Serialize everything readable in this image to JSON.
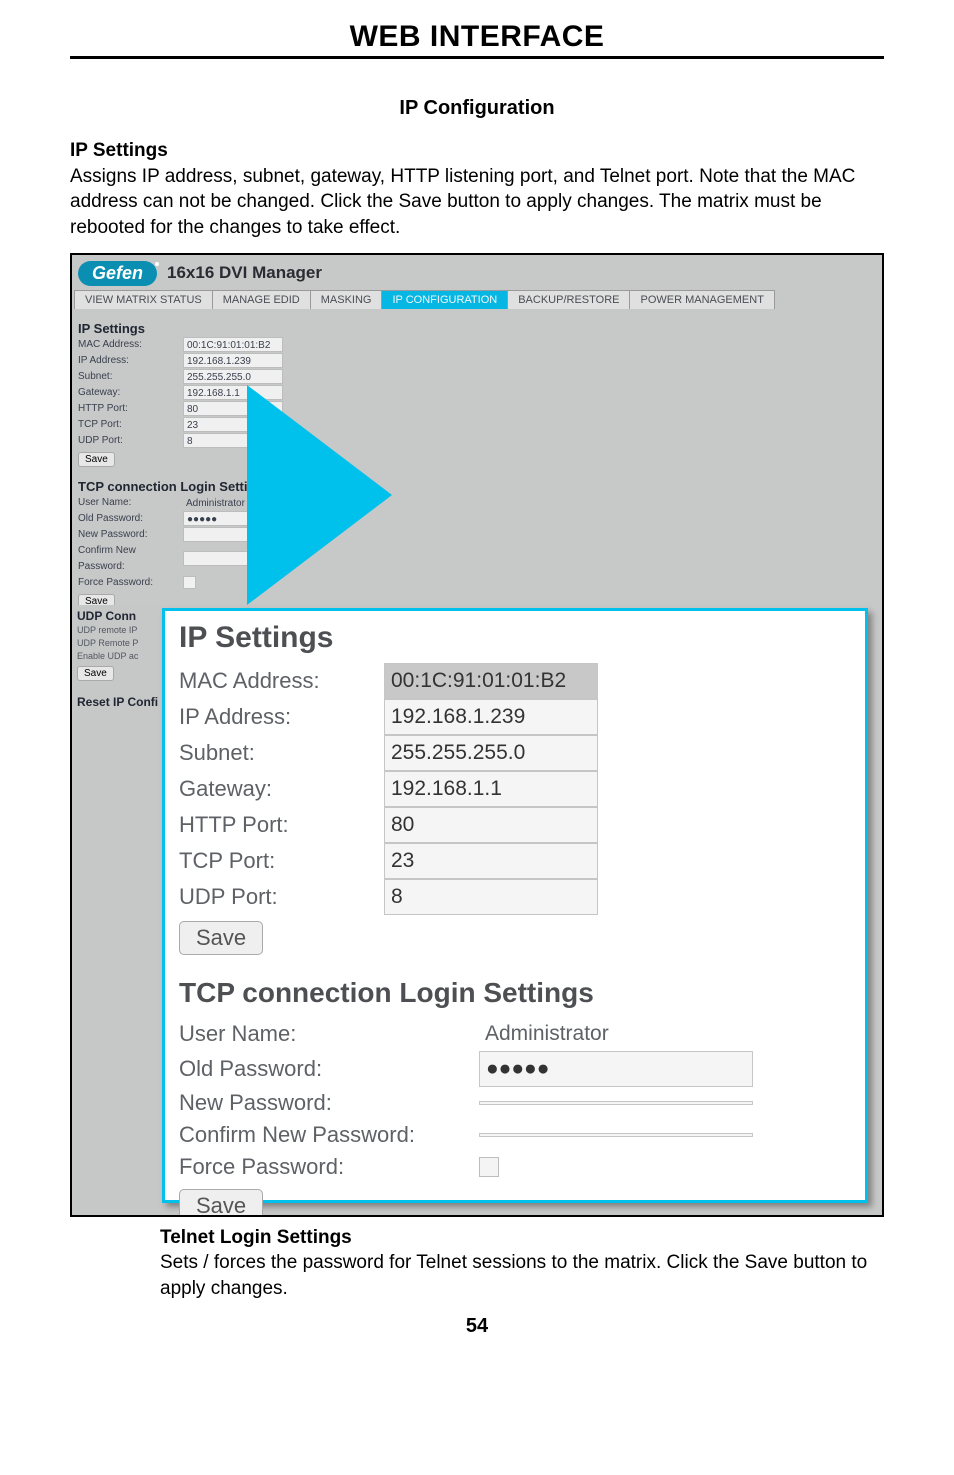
{
  "header": "WEB INTERFACE",
  "subtitle": "IP Configuration",
  "intro": {
    "heading": "IP Settings",
    "text": "Assigns IP address, subnet, gateway, HTTP listening port, and Telnet port. Note that the MAC address can not be changed.  Click the Save button to apply changes.  The matrix must be rebooted for the changes to take effect."
  },
  "brand": {
    "logo": "Gefen",
    "subtitle": "16x16 DVI Manager"
  },
  "tabs": [
    "VIEW MATRIX STATUS",
    "MANAGE EDID",
    "MASKING",
    "IP CONFIGURATION",
    "BACKUP/RESTORE",
    "POWER MANAGEMENT"
  ],
  "active_tab_index": 3,
  "small_ip": {
    "heading": "IP Settings",
    "rows": [
      {
        "label": "MAC Address:",
        "value": "00:1C:91:01:01:B2",
        "readonly": true
      },
      {
        "label": "IP Address:",
        "value": "192.168.1.239"
      },
      {
        "label": "Subnet:",
        "value": "255.255.255.0"
      },
      {
        "label": "Gateway:",
        "value": "192.168.1.1"
      },
      {
        "label": "HTTP Port:",
        "value": "80"
      },
      {
        "label": "TCP Port:",
        "value": "23"
      },
      {
        "label": "UDP Port:",
        "value": "8"
      }
    ],
    "save": "Save"
  },
  "small_tcp": {
    "heading": "TCP connection Login Settings",
    "rows": [
      {
        "label": "User Name:",
        "value": "Administrator",
        "readonly": true
      },
      {
        "label": "Old Password:",
        "value": "●●●●●",
        "password": true
      },
      {
        "label": "New Password:",
        "value": ""
      },
      {
        "label": "Confirm New Password:",
        "value": ""
      },
      {
        "label": "Force Password:",
        "checkbox": true
      }
    ],
    "save": "Save"
  },
  "left_strip": {
    "udp_heading": "UDP Conn",
    "udp_rows": [
      "UDP remote IP",
      "UDP Remote P",
      "Enable UDP ac"
    ],
    "save": "Save",
    "reset_heading": "Reset IP Confi"
  },
  "zoom_ip": {
    "heading": "IP Settings",
    "rows": [
      {
        "label": "MAC Address:",
        "value": "00:1C:91:01:01:B2",
        "readonly": true
      },
      {
        "label": "IP Address:",
        "value": "192.168.1.239"
      },
      {
        "label": "Subnet:",
        "value": "255.255.255.0"
      },
      {
        "label": "Gateway:",
        "value": "192.168.1.1"
      },
      {
        "label": "HTTP Port:",
        "value": "80"
      },
      {
        "label": "TCP Port:",
        "value": "23"
      },
      {
        "label": "UDP Port:",
        "value": "8"
      }
    ],
    "save": "Save"
  },
  "zoom_tcp": {
    "heading": "TCP connection Login Settings",
    "rows": [
      {
        "label": "User Name:",
        "value": "Administrator",
        "readonly": true
      },
      {
        "label": "Old Password:",
        "value": "●●●●●",
        "password": true
      },
      {
        "label": "New Password:",
        "value": ""
      },
      {
        "label": "Confirm New Password:",
        "value": ""
      },
      {
        "label": "Force Password:",
        "checkbox": true
      }
    ],
    "save": "Save"
  },
  "footer": {
    "heading": "Telnet Login Settings",
    "text": "Sets / forces the password for Telnet sessions to the matrix.  Click the Save button to apply changes."
  },
  "page_number": "54"
}
